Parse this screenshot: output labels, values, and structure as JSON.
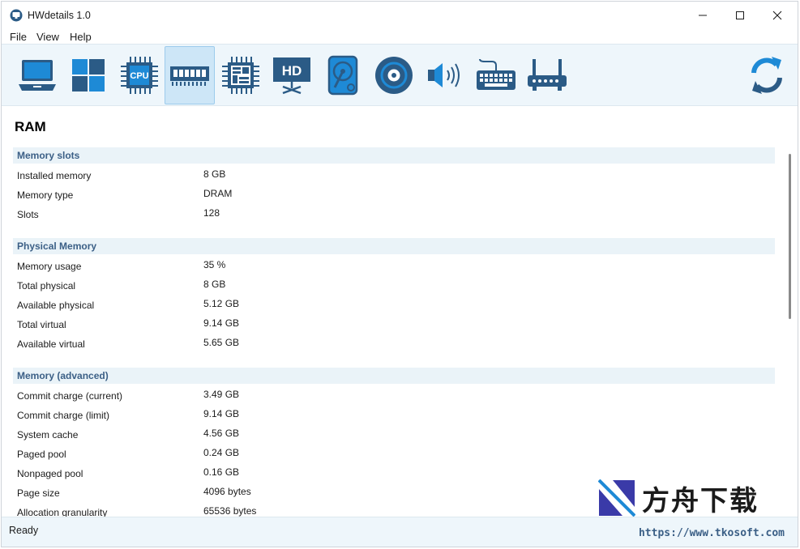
{
  "window": {
    "title": "HWdetails 1.0"
  },
  "menu": {
    "items": [
      "File",
      "View",
      "Help"
    ]
  },
  "toolbar": {
    "tools": [
      "computer-icon",
      "windows-icon",
      "cpu-icon",
      "ram-icon",
      "motherboard-icon",
      "display-icon",
      "disk-icon",
      "optical-drive-icon",
      "speaker-icon",
      "keyboard-icon",
      "router-icon"
    ],
    "active": "ram-icon",
    "refresh": "refresh-icon",
    "cpu_label": "CPU",
    "hd_label": "HD",
    "accent": "#1e8ad6",
    "dark": "#2b5b86"
  },
  "content": {
    "section_title": "RAM",
    "groups": [
      {
        "title": "Memory slots",
        "rows": [
          {
            "label": "Installed memory",
            "value": "8 GB"
          },
          {
            "label": "Memory type",
            "value": "DRAM"
          },
          {
            "label": "Slots",
            "value": "128"
          }
        ]
      },
      {
        "title": "Physical Memory",
        "rows": [
          {
            "label": "Memory usage",
            "value": "35 %"
          },
          {
            "label": "Total physical",
            "value": "8 GB"
          },
          {
            "label": "Available physical",
            "value": "5.12 GB"
          },
          {
            "label": "Total virtual",
            "value": "9.14 GB"
          },
          {
            "label": "Available virtual",
            "value": "5.65 GB"
          }
        ]
      },
      {
        "title": "Memory (advanced)",
        "rows": [
          {
            "label": "Commit charge (current)",
            "value": "3.49 GB"
          },
          {
            "label": "Commit charge (limit)",
            "value": "9.14 GB"
          },
          {
            "label": "System cache",
            "value": "4.56 GB"
          },
          {
            "label": "Paged pool",
            "value": "0.24 GB"
          },
          {
            "label": "Nonpaged pool",
            "value": "0.16 GB"
          },
          {
            "label": "Page size",
            "value": "4096 bytes"
          },
          {
            "label": "Allocation granularity",
            "value": "65536 bytes"
          }
        ]
      }
    ]
  },
  "status": {
    "text": "Ready",
    "link": "https://www.tkosoft.com"
  },
  "watermark": {
    "text": "方舟下载"
  }
}
